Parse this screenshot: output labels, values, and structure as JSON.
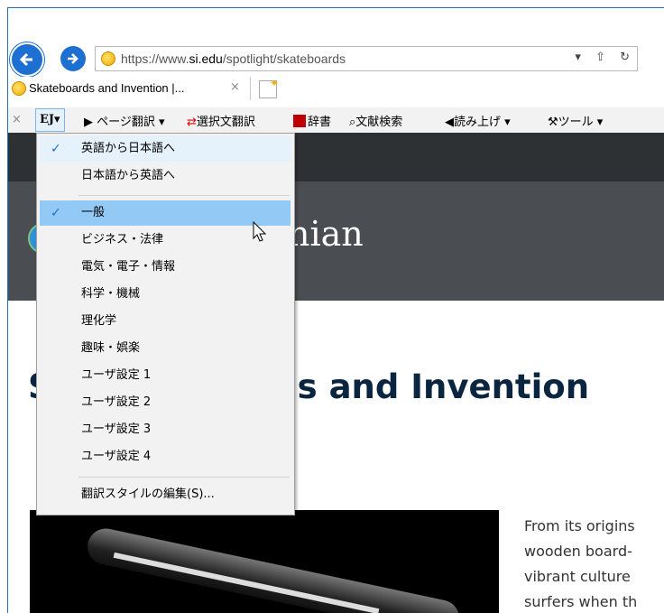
{
  "browser": {
    "url_prefix": "https://www.",
    "url_domain": "si.edu",
    "url_path": "/spotlight/skateboards",
    "address_tools": "▾ ⇧ ↻",
    "tab_title": "Skateboards and Invention |...",
    "tab_close": "×"
  },
  "toolbar": {
    "close": "×",
    "ej": "EJ▾",
    "page_translate": "▶ ページ翻訳 ▾",
    "selection_translate": "選択文翻訳",
    "dictionary": "辞書",
    "doc_search": "文献検索",
    "read_aloud": "読み上げ ▾",
    "tools": "ツール ▾"
  },
  "page": {
    "brand": "nian",
    "title": "ls and Invention",
    "title_initial": "S",
    "paragraph": [
      "From its origins",
      "wooden board-",
      "vibrant culture",
      "surfers when th"
    ]
  },
  "menu": {
    "items": [
      {
        "label": "英語から日本語へ",
        "checked": true
      },
      {
        "label": "日本語から英語へ",
        "checked": false
      },
      {
        "label": "一般",
        "checked": true
      },
      {
        "label": "ビジネス・法律",
        "checked": false
      },
      {
        "label": "電気・電子・情報",
        "checked": false
      },
      {
        "label": "科学・機械",
        "checked": false
      },
      {
        "label": "理化学",
        "checked": false
      },
      {
        "label": "趣味・娯楽",
        "checked": false
      },
      {
        "label": "ユーザ設定 1",
        "checked": false
      },
      {
        "label": "ユーザ設定 2",
        "checked": false
      },
      {
        "label": "ユーザ設定 3",
        "checked": false
      },
      {
        "label": "ユーザ設定 4",
        "checked": false
      },
      {
        "label": "翻訳スタイルの編集(S)...",
        "checked": false
      }
    ],
    "check_glyph": "✓"
  }
}
